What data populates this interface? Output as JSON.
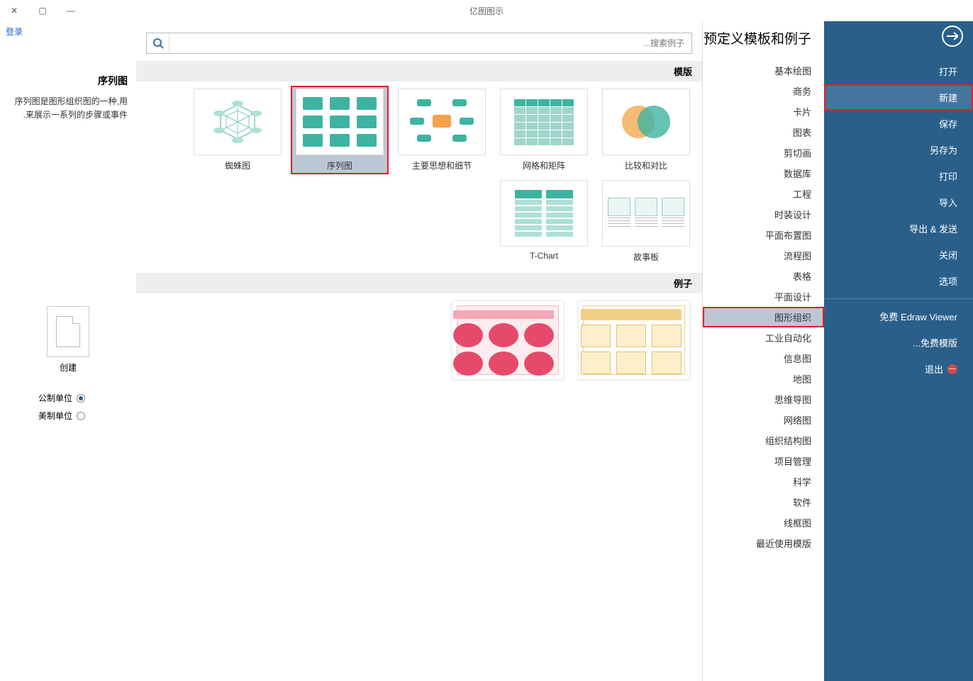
{
  "titlebar": {
    "title": "亿图图示"
  },
  "login": "登录",
  "sidebar": {
    "items": [
      {
        "label": "打开"
      },
      {
        "label": "新建",
        "selected": true
      },
      {
        "label": "保存"
      },
      {
        "label": "另存为"
      },
      {
        "label": "打印"
      },
      {
        "label": "导入"
      },
      {
        "label": "导出 & 发送"
      },
      {
        "label": "关闭"
      },
      {
        "label": "选项"
      }
    ],
    "extra": [
      {
        "label": "免费 Edraw Viewer"
      },
      {
        "label": "免费模版..."
      }
    ],
    "exit": "退出"
  },
  "categories": {
    "heading": "预定义模板和例子",
    "items": [
      {
        "label": "基本绘图"
      },
      {
        "label": "商务"
      },
      {
        "label": "卡片"
      },
      {
        "label": "图表"
      },
      {
        "label": "剪切画"
      },
      {
        "label": "数据库"
      },
      {
        "label": "工程"
      },
      {
        "label": "时装设计"
      },
      {
        "label": "平面布置图"
      },
      {
        "label": "流程图"
      },
      {
        "label": "表格"
      },
      {
        "label": "平面设计"
      },
      {
        "label": "图形组织",
        "selected": true
      },
      {
        "label": "工业自动化"
      },
      {
        "label": "信息图"
      },
      {
        "label": "地图"
      },
      {
        "label": "思维导图"
      },
      {
        "label": "网络图"
      },
      {
        "label": "组织结构图"
      },
      {
        "label": "项目管理"
      },
      {
        "label": "科学"
      },
      {
        "label": "软件"
      },
      {
        "label": "线框图"
      },
      {
        "label": "最近使用模版"
      }
    ]
  },
  "search": {
    "placeholder": "搜索例子..."
  },
  "sections": {
    "templates": "模版",
    "examples": "例子"
  },
  "templates": [
    {
      "label": "比较和对比"
    },
    {
      "label": "网格和矩阵"
    },
    {
      "label": "主要思想和细节"
    },
    {
      "label": "序列图",
      "selected": true
    },
    {
      "label": "蜘蛛图"
    },
    {
      "label": "故事板"
    },
    {
      "label": "T-Chart"
    }
  ],
  "preview": {
    "title": "序列图",
    "desc": "序列图是图形组织图的一种,用来展示一系列的步骤或事件.",
    "create": "创建",
    "unit_metric": "公制单位",
    "unit_us": "美制单位"
  }
}
